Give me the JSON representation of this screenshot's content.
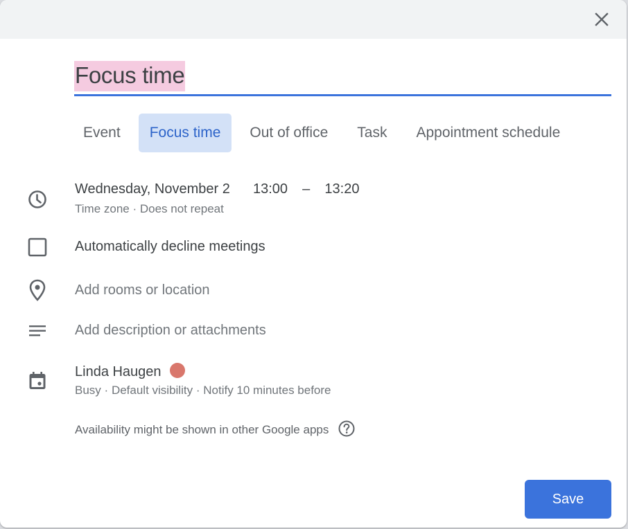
{
  "dialog": {
    "close_icon": "close-icon",
    "title": "Focus time",
    "tabs": [
      {
        "label": "Event",
        "active": false
      },
      {
        "label": "Focus time",
        "active": true
      },
      {
        "label": "Out of office",
        "active": false
      },
      {
        "label": "Task",
        "active": false
      },
      {
        "label": "Appointment schedule",
        "active": false
      }
    ],
    "datetime": {
      "date": "Wednesday, November 2",
      "start": "13:00",
      "separator": "–",
      "end": "13:20",
      "timezone": "Time zone",
      "dot": "·",
      "repeat": "Does not repeat"
    },
    "auto_decline": {
      "label": "Automatically decline meetings",
      "checked": false
    },
    "location": {
      "placeholder": "Add rooms or location"
    },
    "description": {
      "placeholder": "Add description or attachments"
    },
    "calendar": {
      "owner": "Linda Haugen",
      "color": "#d9776c",
      "status": "Busy",
      "visibility": "Default visibility",
      "notify": "Notify 10 minutes before",
      "dot": "·"
    },
    "availability_note": "Availability might be shown in other Google apps",
    "save_label": "Save"
  }
}
